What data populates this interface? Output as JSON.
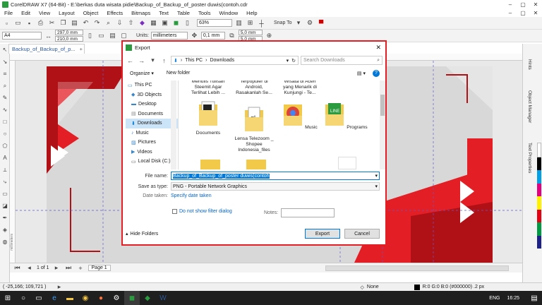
{
  "app": {
    "title": "CorelDRAW X7 (64-Bit) - E:\\berkas duta wisata pidie\\Backup_of_Backup_of_poster duwis(contoh.cdr"
  },
  "window_controls": [
    "–",
    "▢",
    "✕"
  ],
  "doc_window_controls": [
    "–",
    "▢",
    "✕"
  ],
  "menu": [
    "File",
    "Edit",
    "View",
    "Layout",
    "Object",
    "Effects",
    "Bitmaps",
    "Text",
    "Table",
    "Tools",
    "Window",
    "Help"
  ],
  "toolbar": {
    "zoom": "63%",
    "snap_to": "Snap To",
    "page_size": "A4",
    "width": "297,0 mm",
    "height": "210,0 mm",
    "units_label": "Units:",
    "units": "millimeters",
    "nudge": "0,1 mm",
    "dup_x": "5,0 mm",
    "dup_y": "5,0 mm"
  },
  "document_tab": "Backup_of_Backup_of_p...",
  "status": {
    "page_counter": "1 of 1",
    "page_tab": "Page 1",
    "cursor": "( -25,166; 109,721 )",
    "fill": "None",
    "outline": "R:0 G:0 B:0 (#000000)  .2 px",
    "ruler_unit": "millimeters"
  },
  "dock_tabs": [
    "Hints",
    "Object Manager",
    "Text Properties"
  ],
  "taskbar": {
    "lang": "ENG",
    "time": "16:25"
  },
  "dialog": {
    "title": "Export",
    "breadcrumb": [
      "This PC",
      "Downloads"
    ],
    "search_placeholder": "Search Downloads",
    "organize": "Organize ▾",
    "new_folder": "New folder",
    "nav": [
      {
        "label": "This PC",
        "icon": "pc-icon"
      },
      {
        "label": "3D Objects",
        "icon": "cube-icon"
      },
      {
        "label": "Desktop",
        "icon": "desktop-icon"
      },
      {
        "label": "Documents",
        "icon": "documents-icon"
      },
      {
        "label": "Downloads",
        "icon": "download-icon"
      },
      {
        "label": "Music",
        "icon": "music-icon"
      },
      {
        "label": "Pictures",
        "icon": "pictures-icon"
      },
      {
        "label": "Videos",
        "icon": "videos-icon"
      },
      {
        "label": "Local Disk (C:)",
        "icon": "disk-icon"
      }
    ],
    "top_items": [
      "Menulis Tulisan\nSteemit Agar\nTerlihat Lebih ...",
      "Terpopuler di\nAndroid,\nRasakanlah Se...",
      "Wisata di Aceh\nyang Menarik di\nKunjungi - Te..."
    ],
    "items": [
      "Documents",
      "Lensa Telezoom _\nShopee\nIndonesia_files",
      "Music",
      "Programs"
    ],
    "file_name_label": "File name:",
    "file_name": "Backup_of_Backup_of_poster duwis(contoh",
    "save_type_label": "Save as type:",
    "save_type": "PNG - Portable Network Graphics",
    "date_label": "Date taken:",
    "date_link": "Specify date taken",
    "no_filter": "Do not show filter dialog",
    "notes_label": "Notes:",
    "hide_folders": "Hide Folders",
    "export_btn": "Export",
    "cancel_btn": "Cancel"
  },
  "colors": {
    "red": "#e31e24",
    "dark_red": "#b01116",
    "accent": "#0078d7"
  }
}
